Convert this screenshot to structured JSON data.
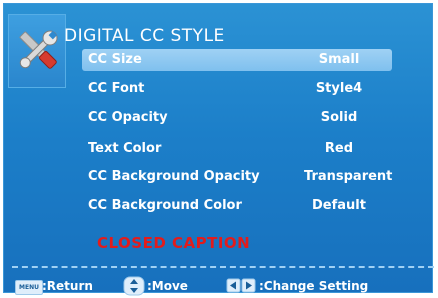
{
  "title": "DIGITAL CC STYLE",
  "header_icon": "wrench-screwdriver-icon",
  "menu": [
    {
      "label": "CC Size",
      "value": "Small",
      "selected": true
    },
    {
      "label": "CC Font",
      "value": "Style4",
      "selected": false
    },
    {
      "label": "CC Opacity",
      "value": "Solid",
      "selected": false
    },
    {
      "label": "Text Color",
      "value": "Red",
      "selected": false
    },
    {
      "label": "CC Background Opacity",
      "value": "Transparent",
      "selected": false
    },
    {
      "label": "CC Background Color",
      "value": "Default",
      "selected": false
    }
  ],
  "preview_text": "CLOSED CAPTION",
  "footer": {
    "menu_key": "MENU",
    "return_label": ":Return",
    "move_label": ":Move",
    "change_label": ":Change Setting"
  },
  "colors": {
    "panel_blue": "#1c7fc9",
    "highlight": "#8fc9f1",
    "caption_red": "#e21c1c"
  }
}
